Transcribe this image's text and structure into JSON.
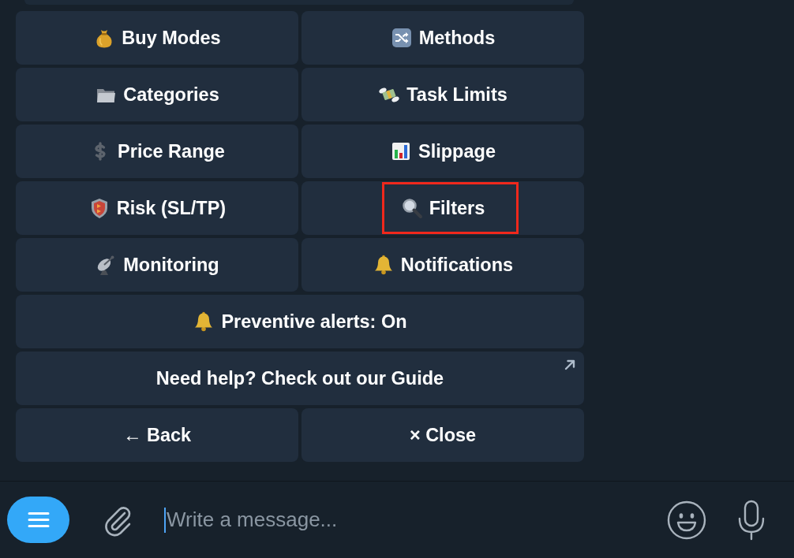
{
  "keyboard": {
    "rows": [
      {
        "buttons": [
          {
            "label": "Buy Modes",
            "kind": "callback",
            "highlighted": false
          },
          {
            "label": "Methods",
            "kind": "callback",
            "highlighted": false
          }
        ]
      },
      {
        "buttons": [
          {
            "label": "Categories",
            "kind": "callback",
            "highlighted": false
          },
          {
            "label": "Task Limits",
            "kind": "callback",
            "highlighted": false
          }
        ]
      },
      {
        "buttons": [
          {
            "label": "Price Range",
            "kind": "callback",
            "highlighted": false
          },
          {
            "label": "Slippage",
            "kind": "callback",
            "highlighted": false
          }
        ]
      },
      {
        "buttons": [
          {
            "label": "Risk (SL/TP)",
            "kind": "callback",
            "highlighted": false
          },
          {
            "label": "Filters",
            "kind": "callback",
            "highlighted": true
          }
        ]
      },
      {
        "buttons": [
          {
            "label": "Monitoring",
            "kind": "callback",
            "highlighted": false
          },
          {
            "label": "Notifications",
            "kind": "callback",
            "highlighted": false
          }
        ]
      },
      {
        "buttons": [
          {
            "label": "Preventive alerts: On",
            "kind": "callback",
            "highlighted": false
          }
        ]
      },
      {
        "buttons": [
          {
            "label": "Need help? Check out our Guide",
            "kind": "url",
            "highlighted": false
          }
        ]
      },
      {
        "buttons": [
          {
            "label": "← Back",
            "kind": "callback",
            "highlighted": false
          },
          {
            "label": "× Close",
            "kind": "callback",
            "highlighted": false
          }
        ]
      }
    ]
  },
  "composer": {
    "placeholder": "Write a message...",
    "focused": true
  }
}
